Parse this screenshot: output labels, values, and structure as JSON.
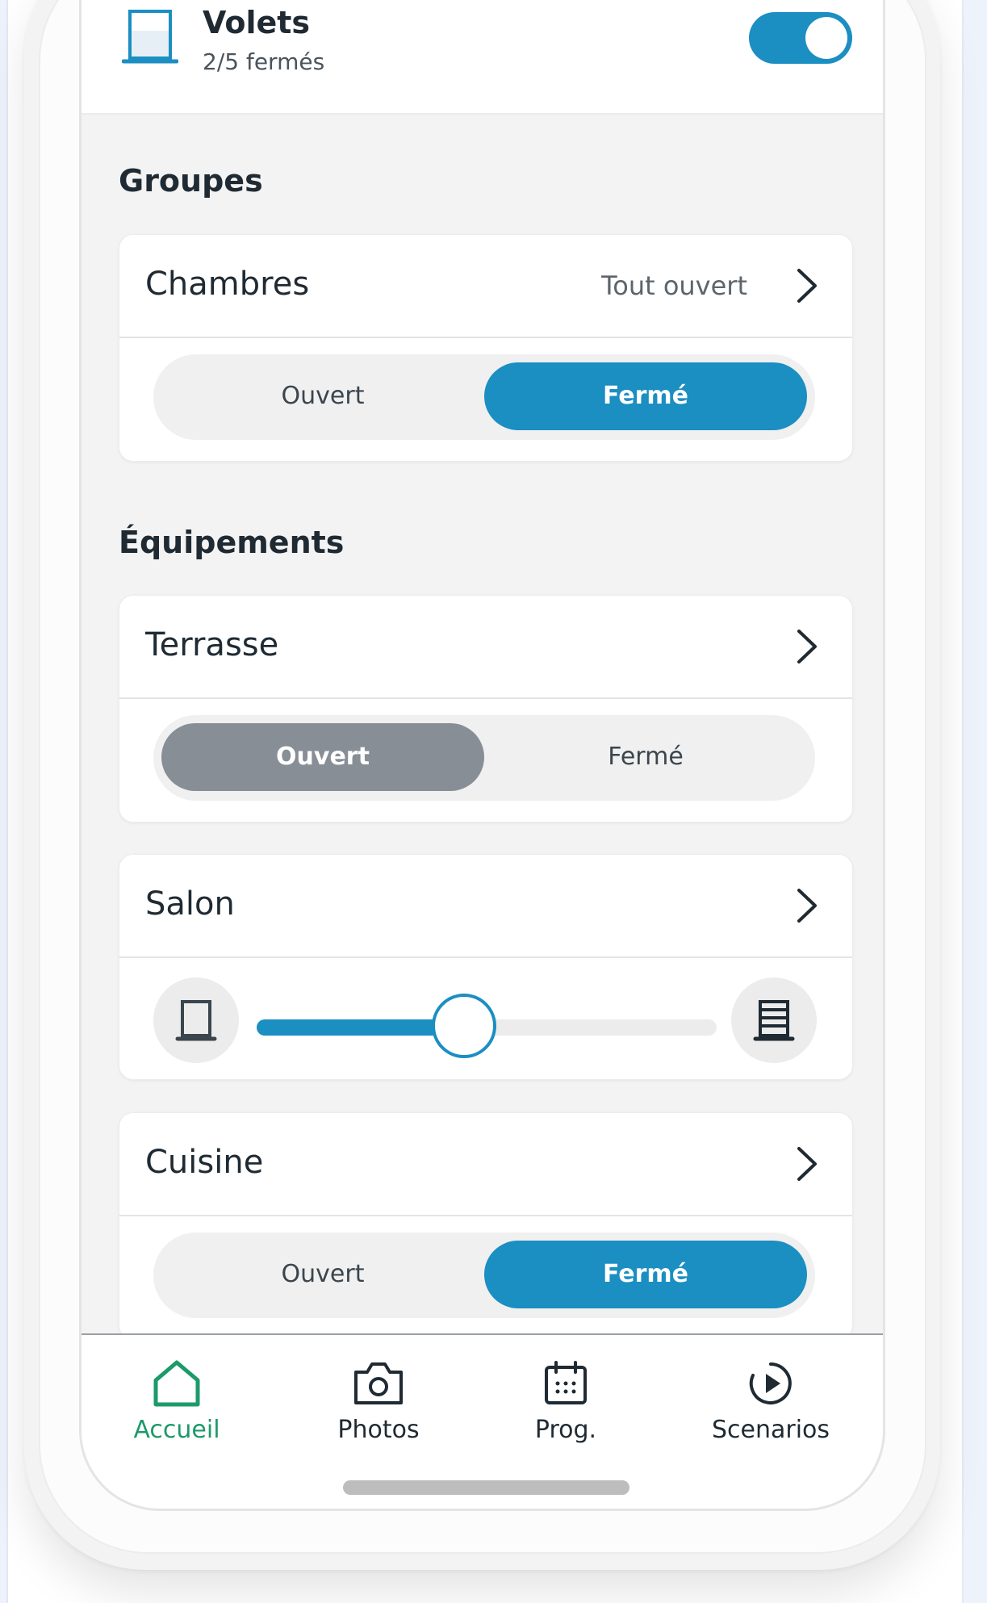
{
  "header": {
    "title": "Volets",
    "subtitle": "2/5 fermés",
    "toggle_on": true
  },
  "groups": {
    "title": "Groupes",
    "items": [
      {
        "name": "Chambres",
        "status": "Tout ouvert",
        "options": [
          "Ouvert",
          "Fermé"
        ],
        "selected": "Fermé"
      }
    ]
  },
  "equipments": {
    "title": "Équipements",
    "items": [
      {
        "name": "Terrasse",
        "options": [
          "Ouvert",
          "Fermé"
        ],
        "selected": "Ouvert"
      },
      {
        "name": "Salon",
        "position_fraction": 0.45
      },
      {
        "name": "Cuisine",
        "options": [
          "Ouvert",
          "Fermé"
        ],
        "selected": "Fermé"
      }
    ]
  },
  "nav": {
    "items": [
      {
        "label": "Accueil",
        "icon": "home-icon",
        "active": true
      },
      {
        "label": "Photos",
        "icon": "camera-icon",
        "active": false
      },
      {
        "label": "Prog.",
        "icon": "calendar-icon",
        "active": false
      },
      {
        "label": "Scenarios",
        "icon": "play-circle-icon",
        "active": false
      }
    ]
  },
  "colors": {
    "accent": "#1b8ec2",
    "active_nav": "#1c9a6a",
    "selected_gray": "#878e96"
  }
}
